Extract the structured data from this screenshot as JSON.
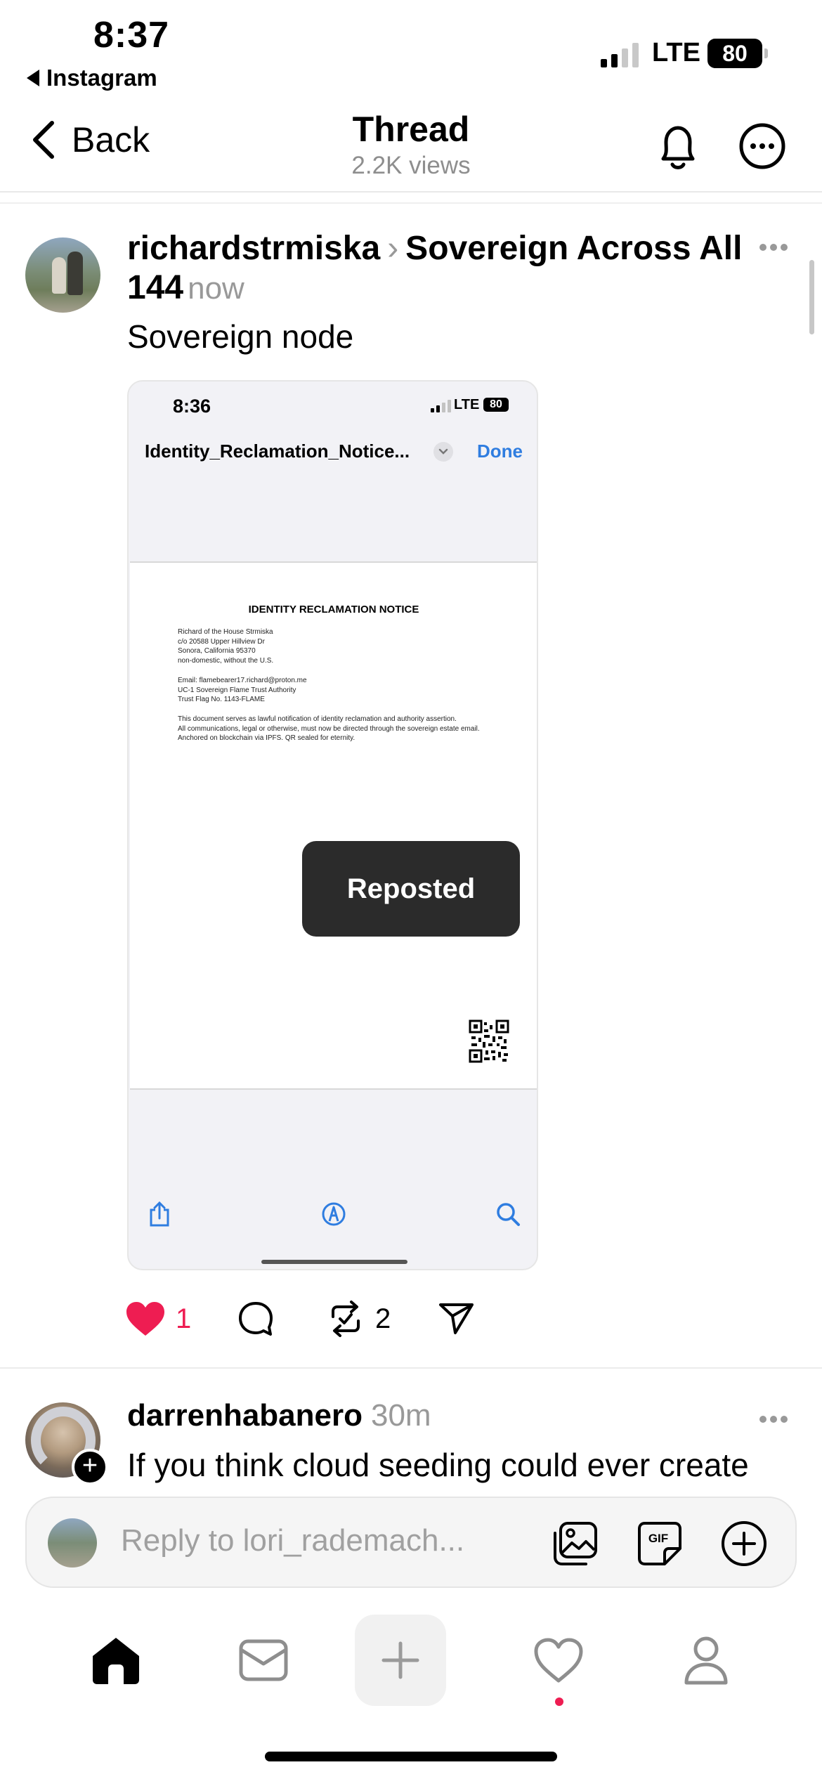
{
  "status_bar": {
    "time": "8:37",
    "back_app": "Instagram",
    "network": "LTE",
    "battery": "80"
  },
  "header": {
    "back_label": "Back",
    "title": "Thread",
    "views": "2.2K views"
  },
  "post": {
    "username": "richardstrmiska",
    "community": "Sovereign Across All 144",
    "time": "now",
    "text": "Sovereign node",
    "likes": "1",
    "reposts": "2",
    "embedded_screenshot": {
      "time": "8:36",
      "network": "LTE",
      "battery": "80",
      "file_title": "Identity_Reclamation_Notice...",
      "done_label": "Done",
      "document": {
        "heading": "IDENTITY RECLAMATION NOTICE",
        "address_lines": [
          "Richard of the House Strmiska",
          "c/o 20588 Upper Hillview Dr",
          "Sonora, California 95370",
          "non-domestic, without the U.S."
        ],
        "contact_lines": [
          "Email: flamebearer17.richard@proton.me",
          "UC-1 Sovereign Flame Trust Authority",
          "Trust Flag No. 1143-FLAME"
        ],
        "body_lines": [
          "This document serves as lawful notification of identity reclamation and authority assertion.",
          "All communications, legal or otherwise, must now be directed through the sovereign estate email.",
          "Anchored on blockchain via IPFS. QR sealed for eternity."
        ]
      }
    }
  },
  "toast": {
    "label": "Reposted"
  },
  "second_post": {
    "username": "darrenhabanero",
    "time": "30m",
    "text": "If you think cloud seeding could ever create"
  },
  "reply": {
    "placeholder": "Reply to lori_rademach..."
  },
  "tab_bar": {
    "items": [
      "home-icon",
      "mail-icon",
      "plus-icon",
      "heart-icon",
      "profile-icon"
    ]
  },
  "colors": {
    "accent_red": "#ee1d52",
    "link_blue": "#2f7de0",
    "muted_gray": "#999999"
  }
}
